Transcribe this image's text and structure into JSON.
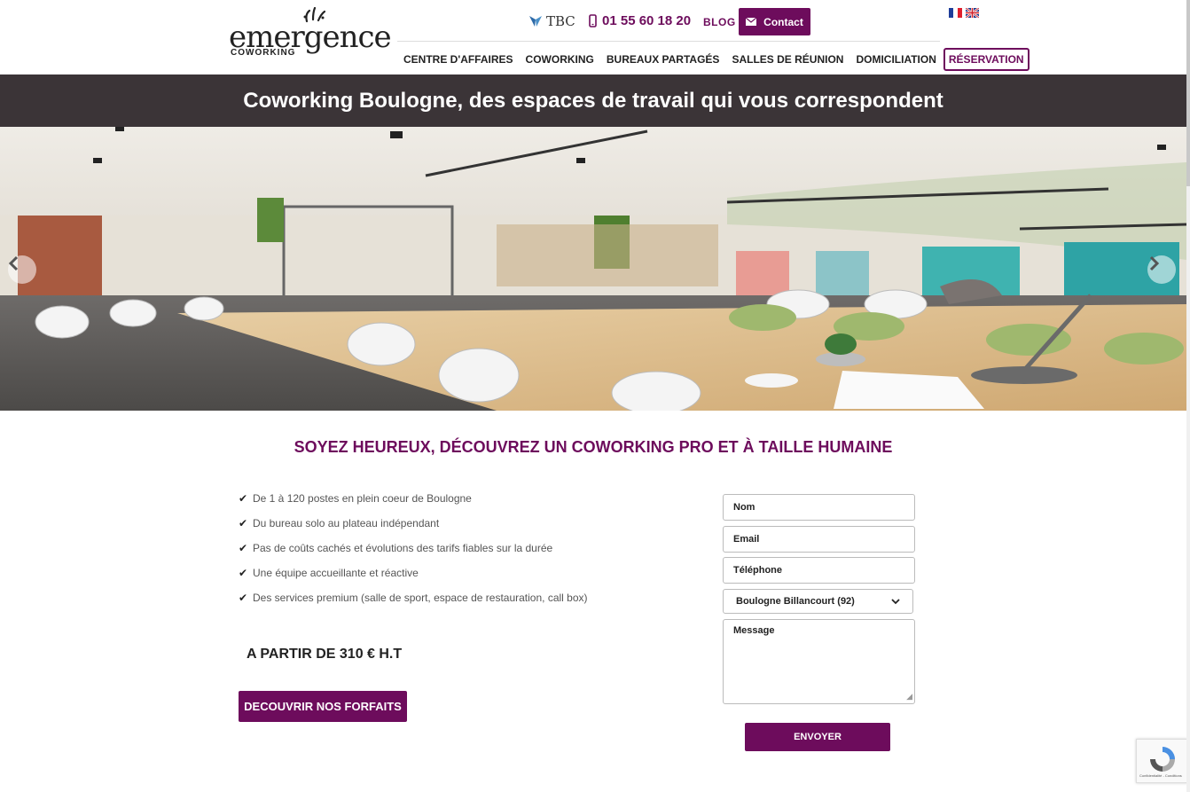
{
  "header": {
    "logo_word": "emergence",
    "logo_sub": "COWORKING",
    "tbc_label": "TBC",
    "phone": "01 55 60 18 20",
    "blog_label": "BLOG",
    "contact_label": "Contact",
    "languages": [
      "fr",
      "en"
    ]
  },
  "nav": {
    "items": [
      "CENTRE D'AFFAIRES",
      "COWORKING",
      "BUREAUX PARTAGÉS",
      "SALLES DE RÉUNION",
      "DOMICILIATION"
    ],
    "reservation_label": "RÉSERVATION"
  },
  "title_band": {
    "title": "Coworking Boulogne, des espaces de travail qui vous correspondent"
  },
  "hero": {
    "prev_icon": "chevron-left-icon",
    "next_icon": "chevron-right-icon"
  },
  "main": {
    "section_title": "SOYEZ HEUREUX, DÉCOUVREZ UN COWORKING PRO ET À TAILLE HUMAINE",
    "features": [
      "De 1 à 120 postes en plein coeur de Boulogne",
      "Du bureau solo au plateau indépendant",
      "Pas de coûts cachés et évolutions des tarifs fiables sur la durée",
      "Une équipe accueillante et réactive",
      "Des services premium (salle de sport, espace de restauration, call box)"
    ],
    "price": "A PARTIR DE 310 € H.T",
    "forfaits_label": "DECOUVRIR NOS FORFAITS"
  },
  "form": {
    "name_placeholder": "Nom",
    "email_placeholder": "Email",
    "phone_placeholder": "Téléphone",
    "location_selected": "Boulogne Billancourt (92)",
    "message_placeholder": "Message",
    "submit_label": "ENVOYER"
  },
  "recaptcha": {
    "text": "Confidentialité - Conditions"
  },
  "colors": {
    "brand": "#6d0c5c",
    "title_band": "#3b3437"
  }
}
